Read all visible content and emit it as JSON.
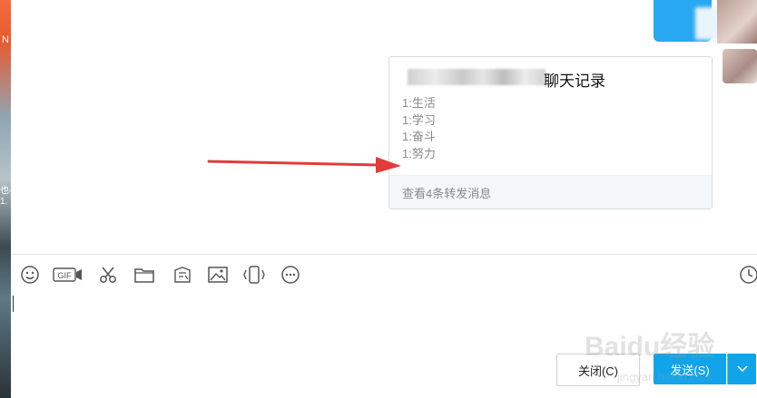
{
  "desktop": {
    "label_a": "N",
    "label_b": "也-\n1."
  },
  "card": {
    "title": "聊天记录",
    "lines": [
      "1:生活",
      "1:学习",
      "1:奋斗",
      "1:努力"
    ],
    "footer": "查看4条转发消息"
  },
  "toolbar": {
    "icons": [
      "emoji-icon",
      "gif-icon",
      "scissors-icon",
      "folder-icon",
      "shake-window-icon",
      "image-icon",
      "vibrate-icon",
      "more-icon",
      "history-clock-icon"
    ],
    "gif_text": "GIF"
  },
  "buttons": {
    "close": "关闭(C)",
    "send": "发送(S)"
  },
  "watermark": {
    "brand": "Baidu经验",
    "url": "jingyan.baidu.com"
  },
  "colors": {
    "accent": "#12a4ea",
    "arrow": "#e23b3b"
  }
}
